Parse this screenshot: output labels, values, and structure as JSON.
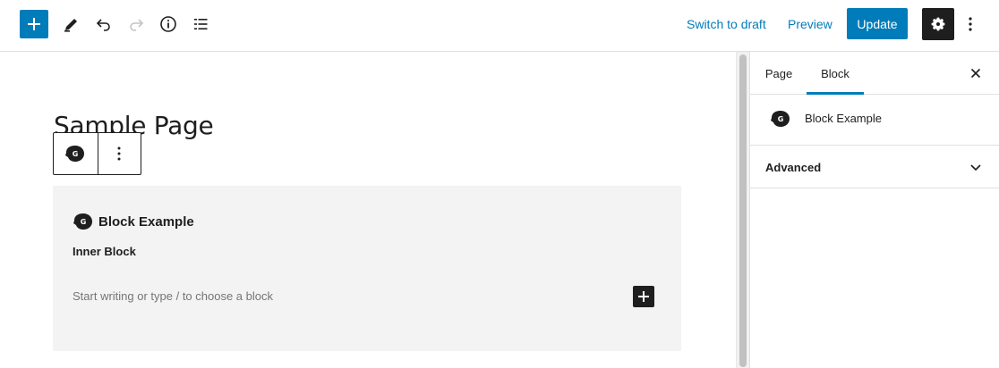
{
  "toolbar": {
    "add_icon": "plus-icon",
    "tools_icon": "pencil-icon",
    "undo_icon": "undo-icon",
    "redo_icon": "redo-icon",
    "info_icon": "info-icon",
    "outline_icon": "list-view-icon",
    "switch_to_draft": "Switch to draft",
    "preview": "Preview",
    "update": "Update",
    "settings_icon": "gear-icon",
    "more_icon": "more-vertical-icon"
  },
  "editor": {
    "page_title": "Sample Page",
    "block_toolbar": {
      "block_icon": "block-example-icon",
      "options_icon": "more-vertical-icon"
    },
    "block": {
      "title": "Block Example",
      "inner_label": "Inner Block",
      "placeholder": "Start writing or type / to choose a block",
      "add_icon": "plus-icon"
    }
  },
  "sidebar": {
    "tabs": [
      {
        "label": "Page",
        "active": false
      },
      {
        "label": "Block",
        "active": true
      }
    ],
    "close_icon": "close-icon",
    "block_card": {
      "title": "Block Example",
      "icon": "block-example-icon"
    },
    "panels": [
      {
        "title": "Advanced",
        "icon": "chevron-down-icon"
      }
    ]
  },
  "colors": {
    "accent": "#007cba",
    "dark": "#1e1e1e",
    "block_bg": "#f3f3f3",
    "muted_text": "#757575"
  }
}
